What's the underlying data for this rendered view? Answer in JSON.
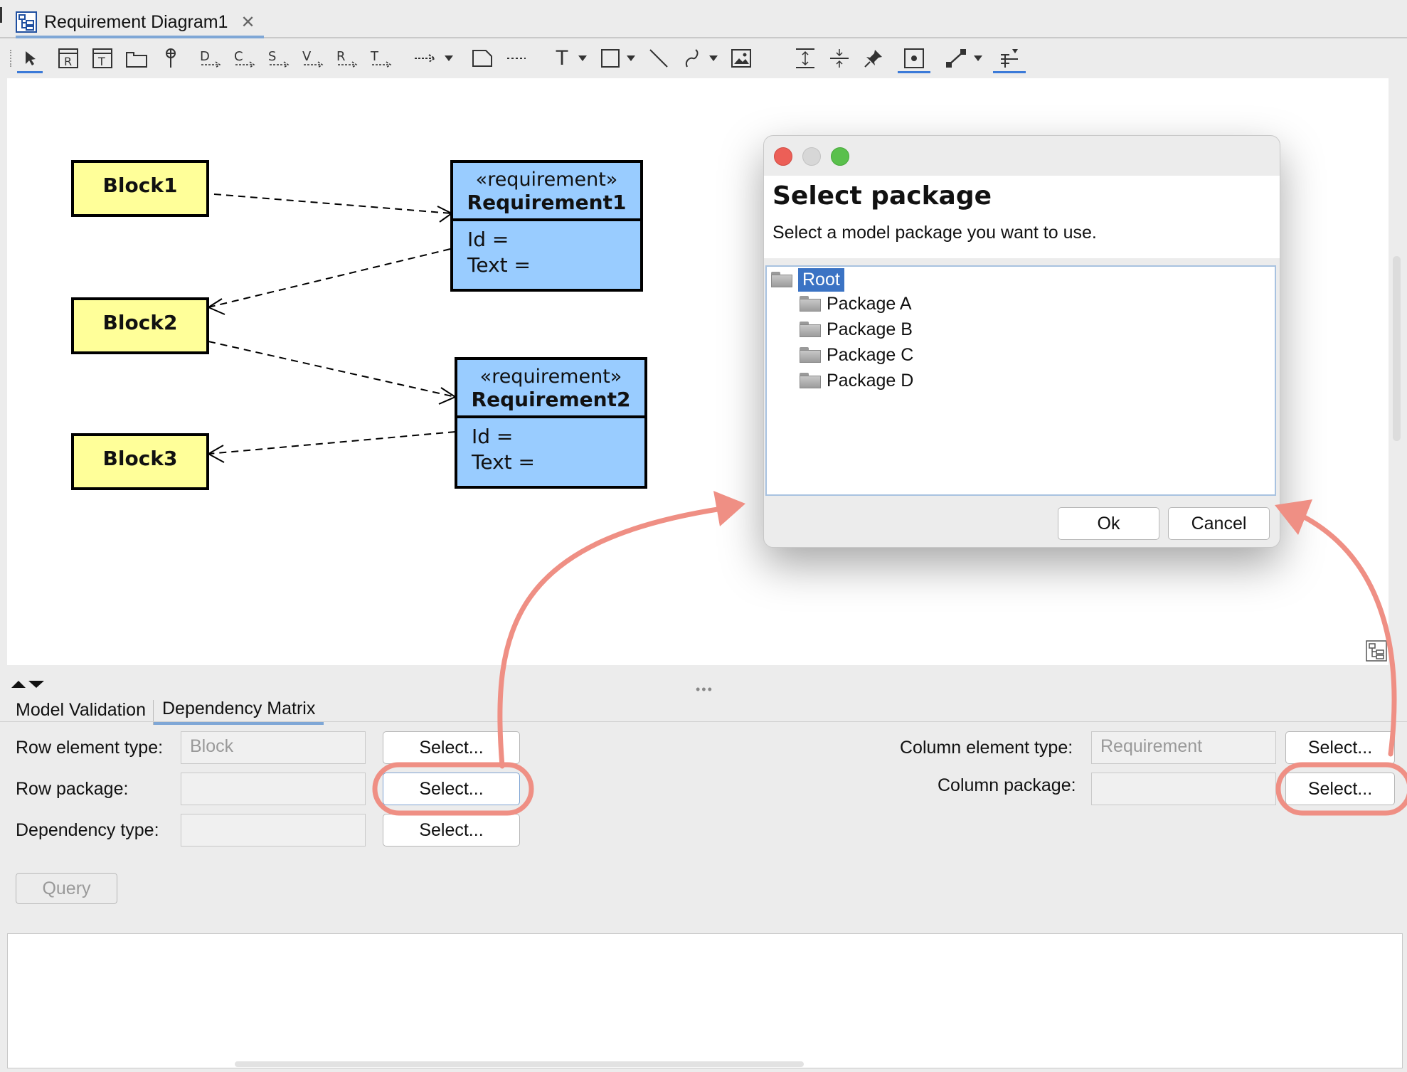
{
  "tab": {
    "title": "Requirement Diagram1",
    "close": "✕"
  },
  "toolbar": {
    "text_tool": "T"
  },
  "diagram": {
    "blocks": [
      "Block1",
      "Block2",
      "Block3"
    ],
    "requirements": [
      {
        "stereotype": "«requirement»",
        "name": "Requirement1",
        "id_label": "Id =",
        "text_label": "Text ="
      },
      {
        "stereotype": "«requirement»",
        "name": "Requirement2",
        "id_label": "Id =",
        "text_label": "Text ="
      }
    ]
  },
  "dialog": {
    "title": "Select package",
    "subtitle": "Select a model package you want to use.",
    "tree": {
      "root": "Root",
      "children": [
        "Package A",
        "Package B",
        "Package C",
        "Package D"
      ]
    },
    "ok": "Ok",
    "cancel": "Cancel"
  },
  "panel": {
    "tabs": [
      "Model Validation",
      "Dependency Matrix"
    ],
    "row_element_type_label": "Row element type:",
    "row_element_type_value": "Block",
    "row_package_label": "Row package:",
    "dependency_type_label": "Dependency type:",
    "column_element_type_label": "Column element type:",
    "column_element_type_value": "Requirement",
    "column_package_label": "Column package:",
    "select": "Select...",
    "query": "Query"
  },
  "colors": {
    "block_fill": "#ffff99",
    "requirement_fill": "#99ccff",
    "annotation": "#ef8f84",
    "selection": "#3b73c4"
  }
}
